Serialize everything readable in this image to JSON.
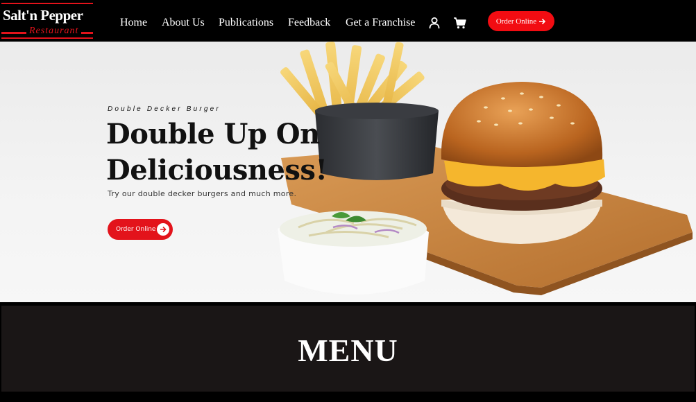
{
  "brand": {
    "name": "Salt'n Pepper",
    "tagline": "Restaurant",
    "accent_color": "#e3131b"
  },
  "nav": {
    "links": [
      {
        "label": "Home"
      },
      {
        "label": "About Us"
      },
      {
        "label": "Publications"
      },
      {
        "label": "Feedback"
      },
      {
        "label": "Get a Franchise"
      }
    ],
    "icons": [
      "user-icon",
      "cart-icon"
    ],
    "order_label": "Order Online"
  },
  "hero": {
    "kicker": "Double Decker Burger",
    "title_line1": "Double Up On",
    "title_line2": "Deliciousness!",
    "description": "Try our double decker burgers and much more.",
    "cta_label": "Order Online",
    "cta_icon": "arrow-right-icon"
  },
  "menu": {
    "title": "MENU"
  }
}
